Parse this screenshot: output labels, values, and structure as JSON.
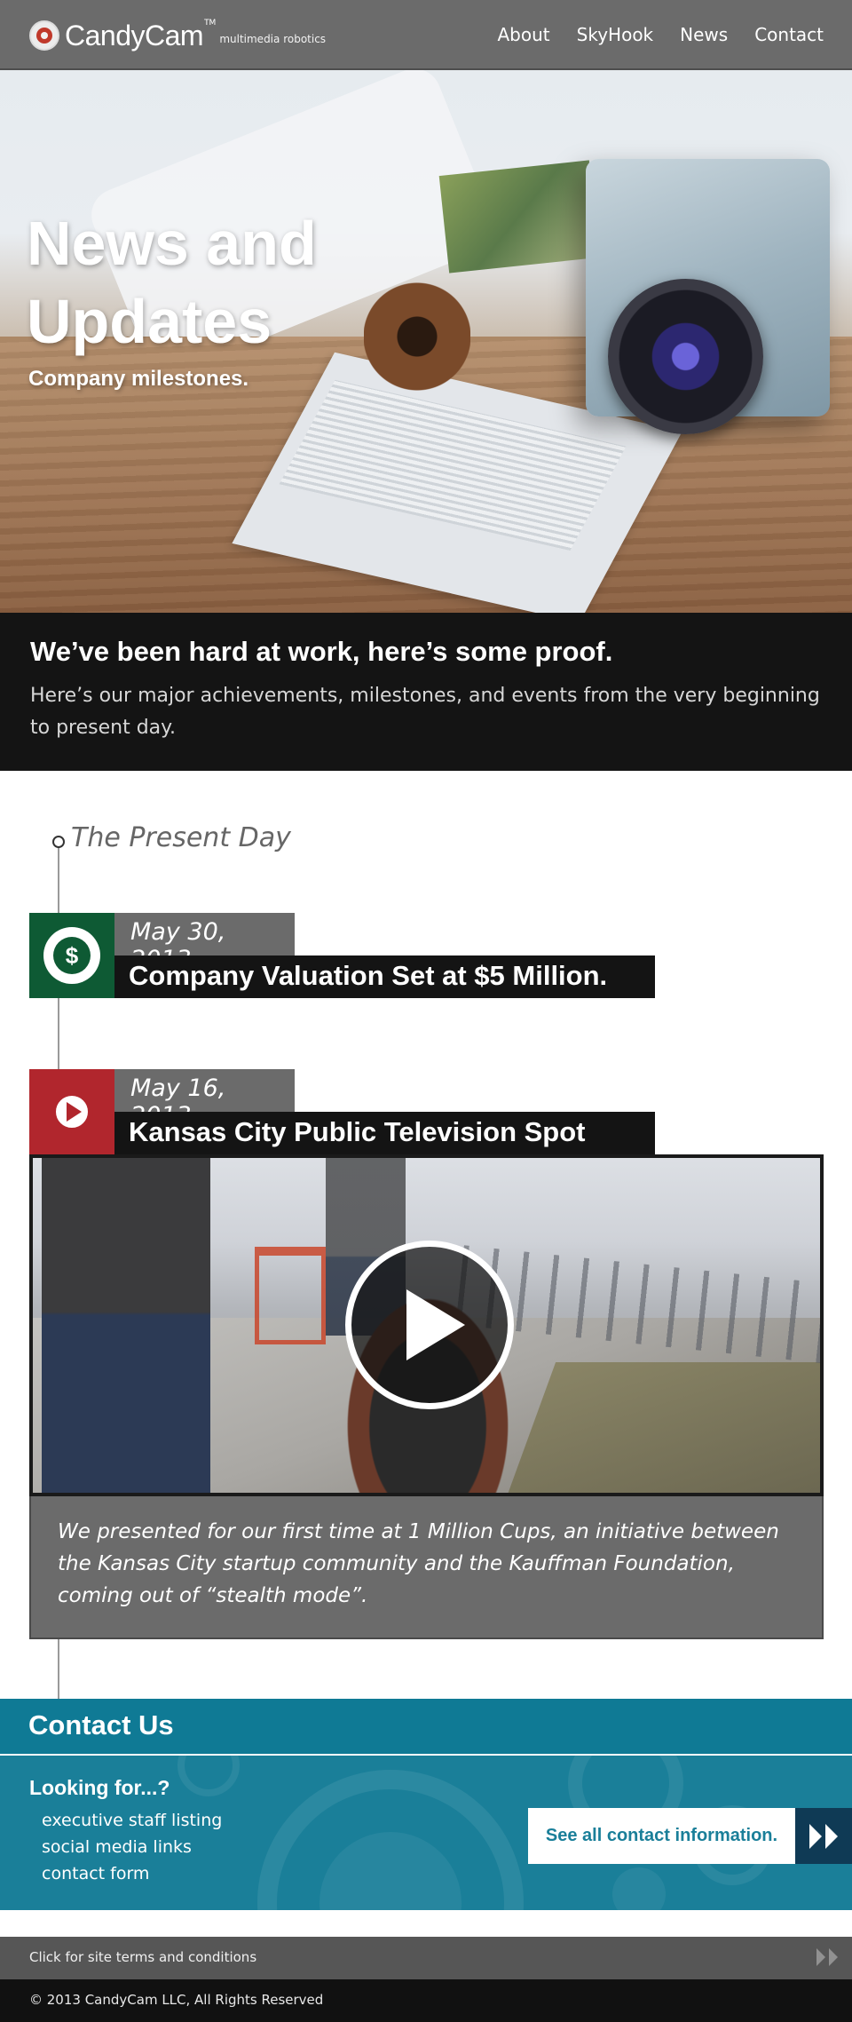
{
  "nav": {
    "brand": "CandyCam",
    "trademark": "TM",
    "tagline": "multimedia robotics",
    "links": [
      "About",
      "SkyHook",
      "News",
      "Contact"
    ]
  },
  "hero": {
    "title": "News and Updates",
    "subtitle": "Company milestones."
  },
  "intro": {
    "heading": "We’ve been hard at work, here’s some proof.",
    "text": "Here’s our major achievements, milestones, and events from the very beginning to present day."
  },
  "timeline": {
    "heading": "The Present Day",
    "events": [
      {
        "date": "May 30, 2013",
        "title": "Company Valuation Set at $5 Million.",
        "icon": "dollar-icon",
        "color": "#0e5a34"
      },
      {
        "date": "May 16, 2013",
        "title": "Kansas City Public Television Spot",
        "icon": "play-icon",
        "color": "#b1262d",
        "caption": "We presented for our first time at 1 Million Cups, an initiative between the Kansas City startup community and the Kauffman Foundation, coming out of “stealth mode”."
      }
    ]
  },
  "contact": {
    "heading": "Contact Us",
    "looking_for": "Looking for...?",
    "links": [
      "executive staff listing",
      "social media links",
      "contact form"
    ],
    "see_all": "See all contact information.",
    "accent": "#1a7f99"
  },
  "footer": {
    "terms": "Click for site terms and conditions",
    "copyright": "© 2013 CandyCam LLC, All Rights Reserved"
  }
}
